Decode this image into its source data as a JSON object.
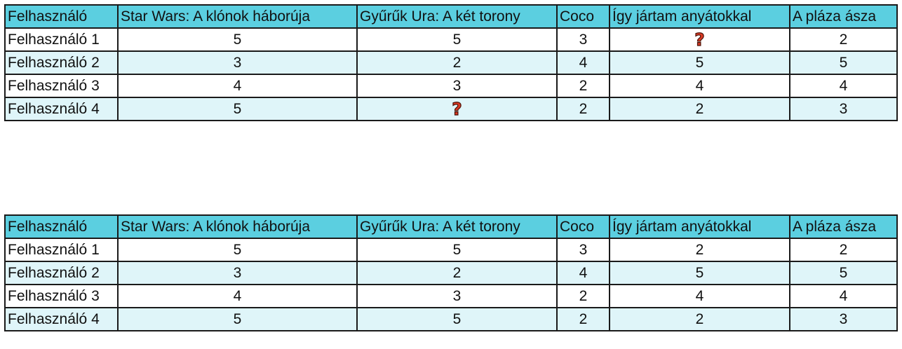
{
  "columns": [
    "Felhasználó",
    "Star Wars: A klónok háborúja",
    "Gyűrűk Ura: A két torony",
    "Coco",
    "Így jártam anyátokkal",
    "A pláza ásza"
  ],
  "missing_marker_icon": "question-mark-icon",
  "colors": {
    "header_bg": "#5bcfe0",
    "stripe_bg": "#dff5f9",
    "question_mark": "#d93a24"
  },
  "table_top": {
    "rows": [
      [
        "Felhasználó 1",
        "5",
        "5",
        "3",
        null,
        "2"
      ],
      [
        "Felhasználó 2",
        "3",
        "2",
        "4",
        "5",
        "5"
      ],
      [
        "Felhasználó 3",
        "4",
        "3",
        "2",
        "4",
        "4"
      ],
      [
        "Felhasználó 4",
        "5",
        null,
        "2",
        "2",
        "3"
      ]
    ]
  },
  "table_bottom": {
    "rows": [
      [
        "Felhasználó 1",
        "5",
        "5",
        "3",
        "2",
        "2"
      ],
      [
        "Felhasználó 2",
        "3",
        "2",
        "4",
        "5",
        "5"
      ],
      [
        "Felhasználó 3",
        "4",
        "3",
        "2",
        "4",
        "4"
      ],
      [
        "Felhasználó 4",
        "5",
        "5",
        "2",
        "2",
        "3"
      ]
    ]
  }
}
